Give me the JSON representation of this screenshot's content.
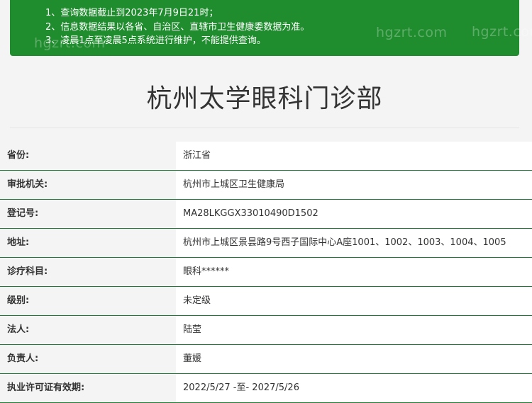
{
  "notice": {
    "lines": [
      "1、查询数据截止到2023年7月9日21时；",
      "2、信息数据结果以各省、自治区、直辖市卫生健康委数据为准。",
      "3、凌晨1点至凌晨5点系统进行维护，不能提供查询。"
    ],
    "watermark": "hgzrt.com",
    "background_color": "#1f8c2e"
  },
  "page_title": "杭州太学眼科门诊部",
  "details": [
    {
      "label": "省份:",
      "value": "浙江省"
    },
    {
      "label": "审批机关:",
      "value": "杭州市上城区卫生健康局"
    },
    {
      "label": "登记号:",
      "value": "MA28LKGGX33010490D1502"
    },
    {
      "label": "地址:",
      "value": "杭州市上城区景昙路9号西子国际中心A座1001、1002、1003、1004、1005"
    },
    {
      "label": "诊疗科目:",
      "value": "眼科******"
    },
    {
      "label": "级别:",
      "value": "未定级"
    },
    {
      "label": "法人:",
      "value": "陆莹"
    },
    {
      "label": "负责人:",
      "value": "董媛"
    },
    {
      "label": "执业许可证有效期:",
      "value": "2022/5/27 -至- 2027/5/26"
    }
  ],
  "row_divider_color": "#1f7a33"
}
